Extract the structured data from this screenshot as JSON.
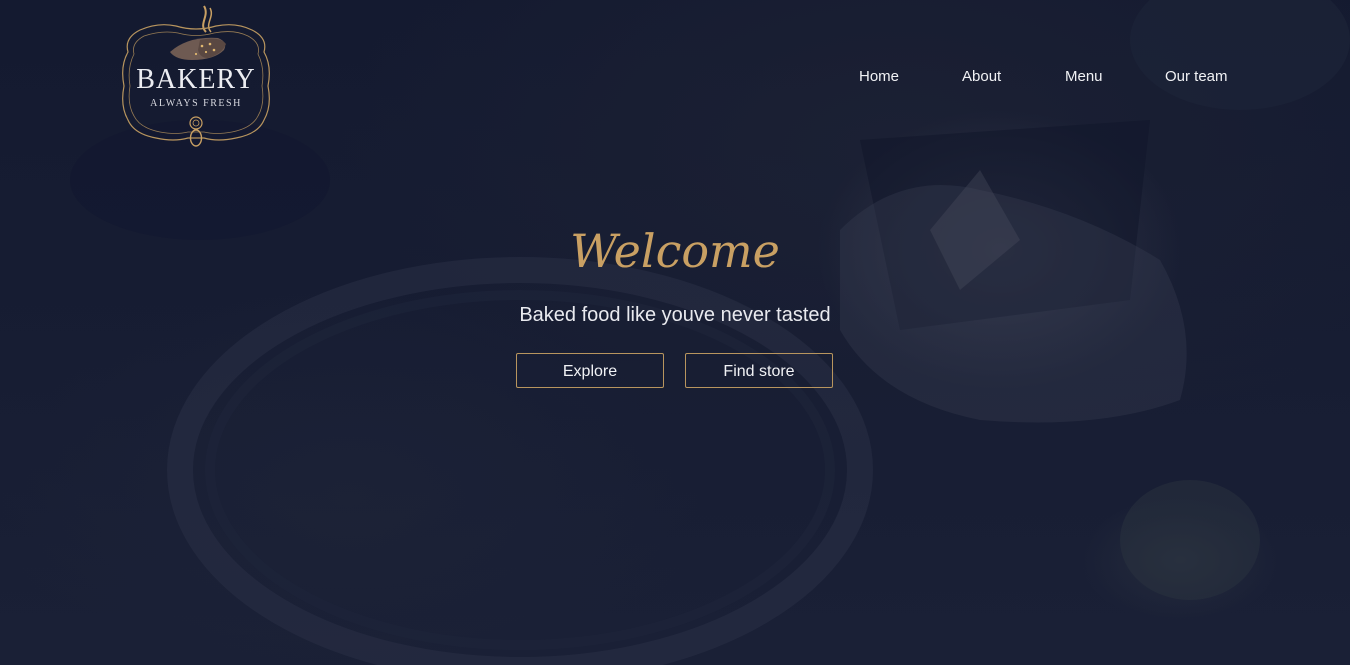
{
  "logo": {
    "title": "BAKERY",
    "subtitle": "ALWAYS FRESH",
    "accent_color": "#c9a063"
  },
  "nav": {
    "items": [
      {
        "label": "Home"
      },
      {
        "label": "About"
      },
      {
        "label": "Menu"
      },
      {
        "label": "Our team"
      }
    ]
  },
  "hero": {
    "title": "Welcome",
    "tagline": "Baked food like youve never tasted",
    "buttons": {
      "explore": "Explore",
      "find_store": "Find store"
    }
  },
  "colors": {
    "background": "#151b31",
    "gold": "#c9a063",
    "text": "#f1f2f5"
  }
}
